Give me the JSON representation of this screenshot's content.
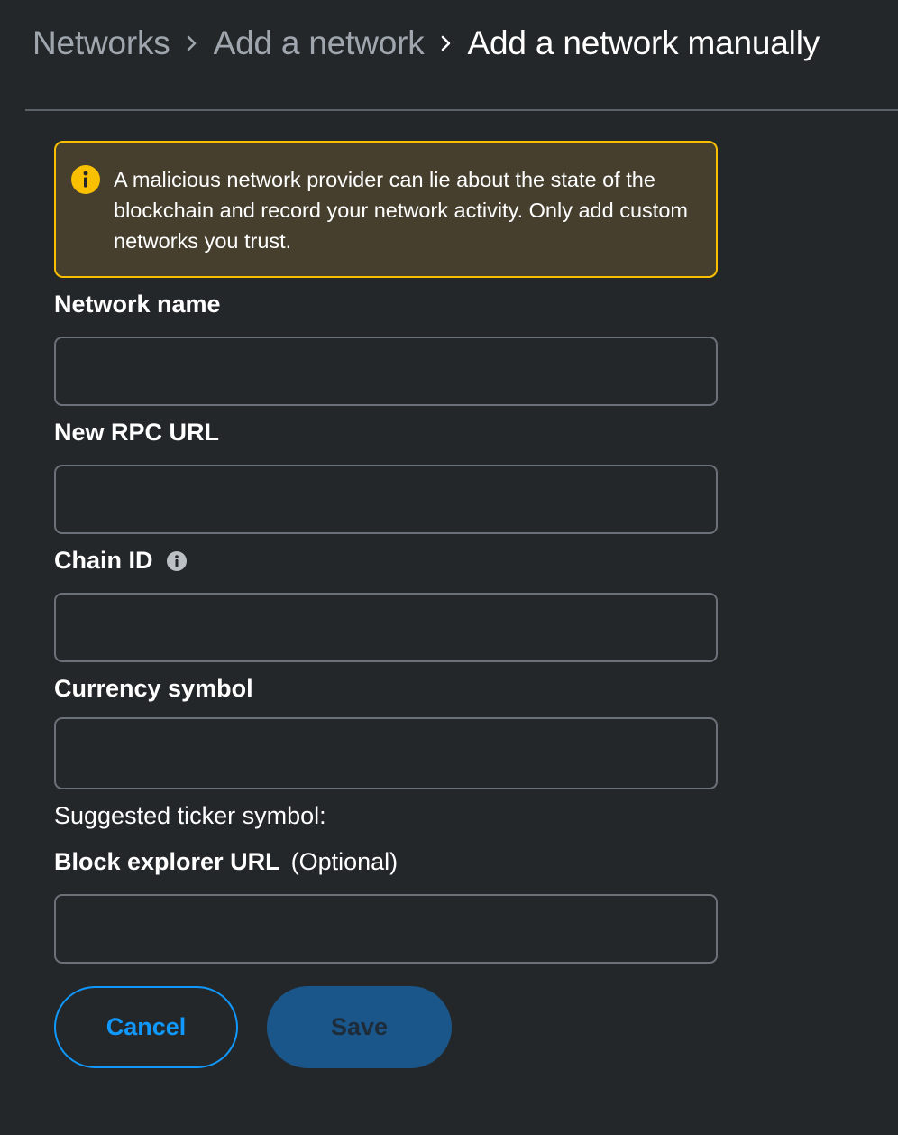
{
  "breadcrumb": {
    "items": [
      {
        "label": "Networks"
      },
      {
        "label": "Add a network"
      },
      {
        "label": "Add a network manually"
      }
    ]
  },
  "warning": {
    "text": "A malicious network provider can lie about the state of the blockchain and record your network activity. Only add custom networks you trust.",
    "icon": "info-circle-icon",
    "color": "#f8c000"
  },
  "form": {
    "network_name": {
      "label": "Network name",
      "value": "",
      "placeholder": ""
    },
    "rpc_url": {
      "label": "New RPC URL",
      "value": "",
      "placeholder": ""
    },
    "chain_id": {
      "label": "Chain ID",
      "value": "",
      "placeholder": "",
      "icon": "info-icon"
    },
    "currency_symbol": {
      "label": "Currency symbol",
      "value": "",
      "placeholder": ""
    },
    "suggested_ticker": "Suggested ticker symbol:",
    "block_explorer": {
      "label": "Block explorer URL",
      "optional_label": "(Optional)",
      "value": "",
      "placeholder": ""
    }
  },
  "buttons": {
    "cancel_label": "Cancel",
    "save_label": "Save"
  },
  "colors": {
    "accent": "#1098fc",
    "background": "#24272a",
    "warning_border": "#f8c000",
    "save_disabled_bg": "#1a5689"
  }
}
